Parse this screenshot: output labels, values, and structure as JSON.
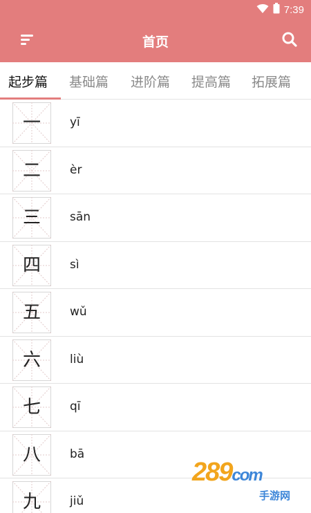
{
  "status": {
    "time": "7:39"
  },
  "header": {
    "title": "首页"
  },
  "tabs": [
    {
      "label": "起步篇",
      "active": true
    },
    {
      "label": "基础篇",
      "active": false
    },
    {
      "label": "进阶篇",
      "active": false
    },
    {
      "label": "提高篇",
      "active": false
    },
    {
      "label": "拓展篇",
      "active": false
    }
  ],
  "items": [
    {
      "char": "一",
      "pinyin": "yī"
    },
    {
      "char": "二",
      "pinyin": "èr"
    },
    {
      "char": "三",
      "pinyin": "sān"
    },
    {
      "char": "四",
      "pinyin": "sì"
    },
    {
      "char": "五",
      "pinyin": "wǔ"
    },
    {
      "char": "六",
      "pinyin": "liù"
    },
    {
      "char": "七",
      "pinyin": "qī"
    },
    {
      "char": "八",
      "pinyin": "bā"
    },
    {
      "char": "九",
      "pinyin": "jiǔ"
    }
  ],
  "watermark": {
    "brand": "289",
    "suffix": "com",
    "sub": "手游网"
  },
  "colors": {
    "accent": "#e37d7d",
    "watermark_orange": "#f2a51d",
    "watermark_blue": "#3d86d8"
  }
}
